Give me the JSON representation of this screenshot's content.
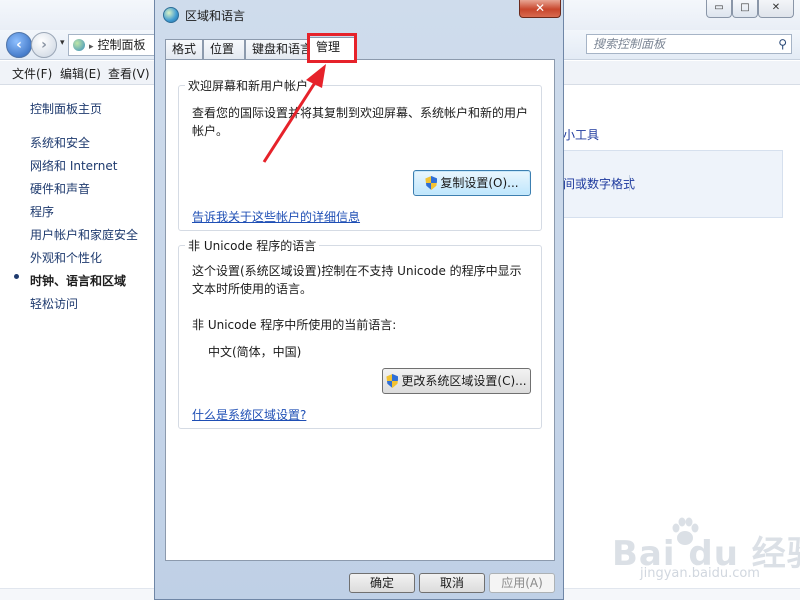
{
  "background": {
    "window_controls": [
      "▭",
      "□",
      "✕"
    ],
    "address": {
      "current": "控制面板",
      "separator": "▸"
    },
    "search_placeholder": "搜索控制面板",
    "menu": [
      "文件(F)",
      "编辑(E)",
      "查看(V)"
    ],
    "sidebar": {
      "home": "控制面板主页",
      "items": [
        "系统和安全",
        "网络和 Internet",
        "硬件和声音",
        "程序",
        "用户帐户和家庭安全",
        "外观和个性化",
        "时钟、语言和区域",
        "轻松访问"
      ],
      "active_index": 6
    },
    "content_links": [
      "小工具",
      "间或数字格式"
    ],
    "watermark": {
      "main": "Bai  du 经验",
      "sub": "jingyan.baidu.com"
    }
  },
  "dialog": {
    "title": "区域和语言",
    "close_label": "✕",
    "tabs": [
      "格式",
      "位置",
      "键盘和语言",
      "管理"
    ],
    "active_tab": "管理",
    "welcome_group": {
      "legend": "欢迎屏幕和新用户帐户",
      "description": "查看您的国际设置并将其复制到欢迎屏幕、系统帐户和新的用户帐户。",
      "copy_button": "复制设置(O)...",
      "link": "告诉我关于这些帐户的详细信息"
    },
    "unicode_group": {
      "legend": "非 Unicode 程序的语言",
      "description": "这个设置(系统区域设置)控制在不支持 Unicode 的程序中显示文本时所使用的语言。",
      "current_label": "非 Unicode 程序中所使用的当前语言:",
      "current_value": "中文(简体，中国)",
      "change_button": "更改系统区域设置(C)...",
      "link": "什么是系统区域设置?"
    },
    "buttons": {
      "ok": "确定",
      "cancel": "取消",
      "apply": "应用(A)"
    }
  },
  "colors": {
    "highlight": "#e6222a",
    "link": "#1f4fb5"
  }
}
